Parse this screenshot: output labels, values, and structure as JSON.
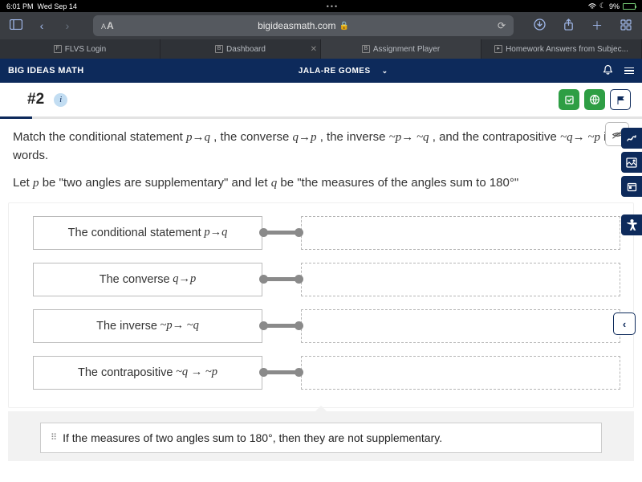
{
  "status": {
    "time": "6:01 PM",
    "date": "Wed Sep 14",
    "dots": "•••",
    "battery_pct": "9%"
  },
  "browser": {
    "url_display": "bigideasmath.com",
    "aa_small": "A",
    "aa_big": "A",
    "tabs": [
      {
        "fav": "F",
        "label": "FLVS Login"
      },
      {
        "fav": "B",
        "label": "Dashboard"
      },
      {
        "fav": "B",
        "label": "Assignment Player"
      },
      {
        "fav": "▸",
        "label": "Homework Answers from Subjec..."
      }
    ]
  },
  "app": {
    "brand": "BIG IDEAS MATH",
    "user": "JALA-RE GOMES"
  },
  "question": {
    "number": "#2",
    "info_glyph": "i",
    "line1_pre": "Match the conditional statement ",
    "s_cond": "p→q",
    "line1_conv_pre": " , the converse ",
    "s_conv": "q→p",
    "line1_inv_pre": " , the inverse  ",
    "s_inv": "~p→ ~q",
    "line1_post": " , and the contrapositive  ",
    "s_contra": "~q→ ~p",
    "line1_end": " in words.",
    "line2_pre": "Let ",
    "var_p": "p",
    "line2_mid1": " be \"two angles are supplementary\" and let ",
    "var_q": "q",
    "line2_mid2": " be \"the measures of the angles sum to 180°\""
  },
  "labels": {
    "row1_pre": "The conditional statement  ",
    "row1_math": "p→q",
    "row2_pre": "The converse  ",
    "row2_math": "q→p",
    "row3_pre": "The inverse   ",
    "row3_math": "~p→ ~q",
    "row4_pre": "The contrapositive   ",
    "row4_math": "~q → ~p"
  },
  "answer_option": "If the measures of two angles sum to 180°, then they are not supplementary.",
  "caret": "‹"
}
